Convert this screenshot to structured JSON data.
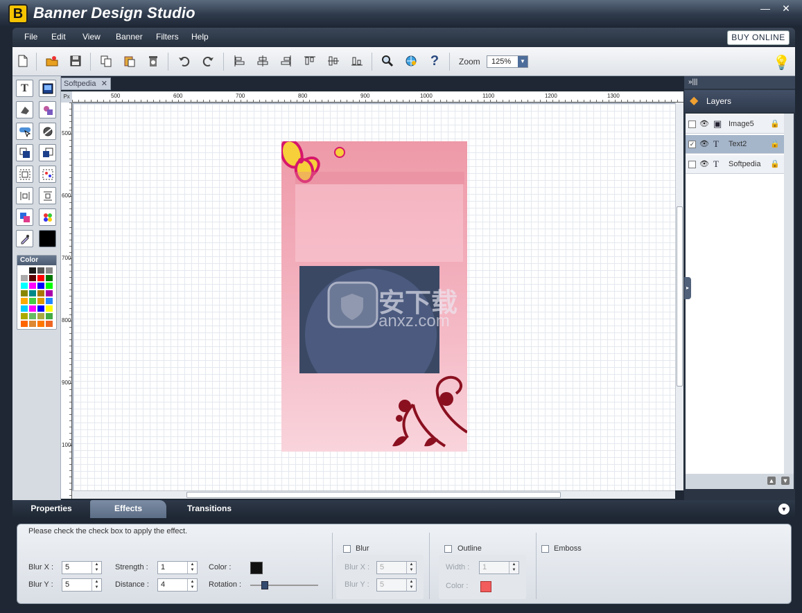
{
  "window": {
    "title": "Banner Design Studio",
    "logo_letter": "B",
    "minimize": "—",
    "close": "✕"
  },
  "menu": {
    "items": [
      "File",
      "Edit",
      "View",
      "Banner",
      "Filters",
      "Help"
    ],
    "buy_online": "BUY ONLINE"
  },
  "toolbar": {
    "zoom_label": "Zoom",
    "zoom_value": "125%"
  },
  "document": {
    "tab_label": "Softpedia",
    "tab_close": "✕",
    "ruler_unit": "Px",
    "ruler_h": [
      "500",
      "600",
      "700",
      "800",
      "900",
      "1000",
      "1100",
      "1200",
      "1300"
    ],
    "ruler_v": [
      "500",
      "600",
      "700",
      "800",
      "900",
      "1000"
    ]
  },
  "left_tools": {
    "color_title": "Color",
    "text_tool": "T"
  },
  "palette": [
    "#ffffff",
    "#1a1a1a",
    "#555555",
    "#888888",
    "#aaaaaa",
    "#5a0000",
    "#ff0000",
    "#007700",
    "#00ffff",
    "#ff00ff",
    "#0000ff",
    "#00ff00",
    "#888800",
    "#008888",
    "#aa7700",
    "#aa00aa",
    "#ffaa00",
    "#44cc44",
    "#dd9900",
    "#2288ff",
    "#00ccff",
    "#ff00ff",
    "#0000ff",
    "#ffff00",
    "#aaaa00",
    "#66bb66",
    "#aaaa44",
    "#44aa44",
    "#ff6600",
    "#dd8833",
    "#ff7700",
    "#ee6622"
  ],
  "layers_panel": {
    "header": "»|||",
    "title": "Layers",
    "layers": [
      {
        "name": "Image5",
        "checked": "",
        "icon": "▣"
      },
      {
        "name": "Text2",
        "checked": "✓",
        "icon": "T"
      },
      {
        "name": "Softpedia",
        "checked": "",
        "icon": "T"
      }
    ]
  },
  "bottom_tabs": {
    "tabs": [
      "Properties",
      "Effects",
      "Transitions"
    ],
    "active": "Effects"
  },
  "effects": {
    "hint": "Please check the check box to apply the effect.",
    "shadow": {
      "blur_x_label": "Blur X :",
      "blur_x": "5",
      "blur_y_label": "Blur Y :",
      "blur_y": "5",
      "strength_label": "Strength :",
      "strength": "1",
      "distance_label": "Distance :",
      "distance": "4",
      "color_label": "Color :",
      "rotation_label": "Rotation :",
      "color": "#111111"
    },
    "blur": {
      "label": "Blur",
      "blur_x_label": "Blur X :",
      "blur_x": "5",
      "blur_y_label": "Blur Y :",
      "blur_y": "5"
    },
    "outline": {
      "label": "Outline",
      "width_label": "Width :",
      "width": "1",
      "color_label": "Color :",
      "color": "#f25c5c"
    },
    "emboss": {
      "label": "Emboss"
    }
  },
  "watermark": {
    "text": "安下载",
    "subtext": "anxz.com"
  }
}
